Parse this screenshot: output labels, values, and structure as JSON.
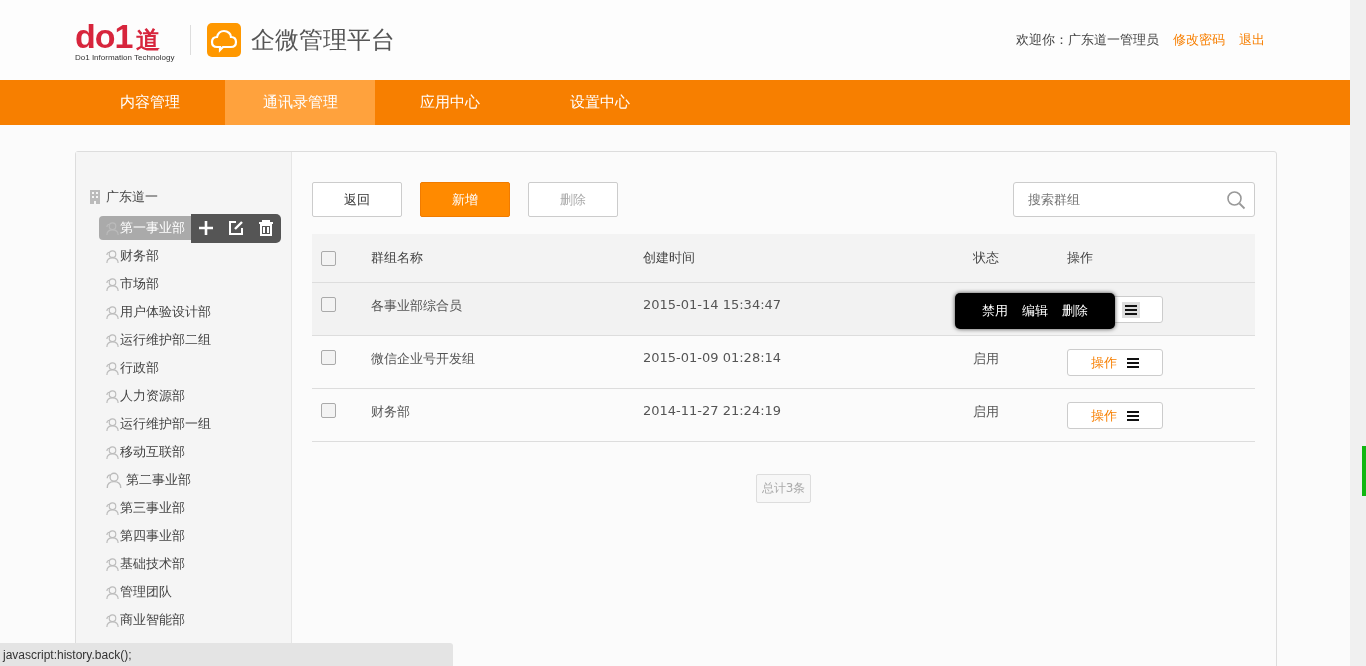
{
  "header": {
    "logo_mark": "do1",
    "logo_char": "道",
    "logo_tagline": "Do1 Information Technology",
    "product_title": "企微管理平台",
    "welcome": "欢迎你：广东道一管理员",
    "links": [
      "修改密码",
      "退出"
    ]
  },
  "nav": [
    {
      "label": "内容管理",
      "selected": false
    },
    {
      "label": "通讯录管理",
      "selected": true
    },
    {
      "label": "应用中心",
      "selected": false
    },
    {
      "label": "设置中心",
      "selected": false
    }
  ],
  "tree": {
    "label": "广东道一",
    "children": [
      {
        "label": "第一事业部",
        "selected": true
      },
      {
        "label": "财务部",
        "selected": false
      },
      {
        "label": "市场部",
        "selected": false
      },
      {
        "label": "用户体验设计部",
        "selected": false
      },
      {
        "label": "运行维护部二组",
        "selected": false
      },
      {
        "label": "行政部",
        "selected": false
      },
      {
        "label": "人力资源部",
        "selected": false
      },
      {
        "label": "运行维护部一组",
        "selected": false
      },
      {
        "label": "移动互联部",
        "selected": false
      },
      {
        "label": "第二事业部",
        "selected": false
      },
      {
        "label": "第三事业部",
        "selected": false
      },
      {
        "label": "第四事业部",
        "selected": false
      },
      {
        "label": "基础技术部",
        "selected": false
      },
      {
        "label": "管理团队",
        "selected": false
      },
      {
        "label": "商业智能部",
        "selected": false
      }
    ]
  },
  "toolbar": [
    {
      "label": "返回",
      "kind": "plain",
      "disabled": false
    },
    {
      "label": "新增",
      "kind": "primary",
      "disabled": false
    },
    {
      "label": "删除",
      "kind": "plain",
      "disabled": true
    }
  ],
  "search": {
    "placeholder": "搜索群组"
  },
  "table": {
    "select_all": false,
    "columns": [
      "群组名称",
      "创建时间",
      "状态",
      "操作"
    ],
    "rows": [
      {
        "checked": false,
        "hovered": true,
        "name": "各事业部综合员",
        "created": "2015-01-14 15:34:47",
        "menu": [
          "禁用",
          "编辑",
          "删除"
        ]
      },
      {
        "checked": false,
        "hovered": false,
        "name": "微信企业号开发组",
        "created": "2015-01-09 01:28:14",
        "status": "启用",
        "action": "操作"
      },
      {
        "checked": false,
        "hovered": false,
        "name": "财务部",
        "created": "2014-11-27 21:24:19",
        "status": "启用",
        "action": "操作"
      }
    ]
  },
  "total": "总计3条",
  "status_bar": "javascript:history.back();"
}
